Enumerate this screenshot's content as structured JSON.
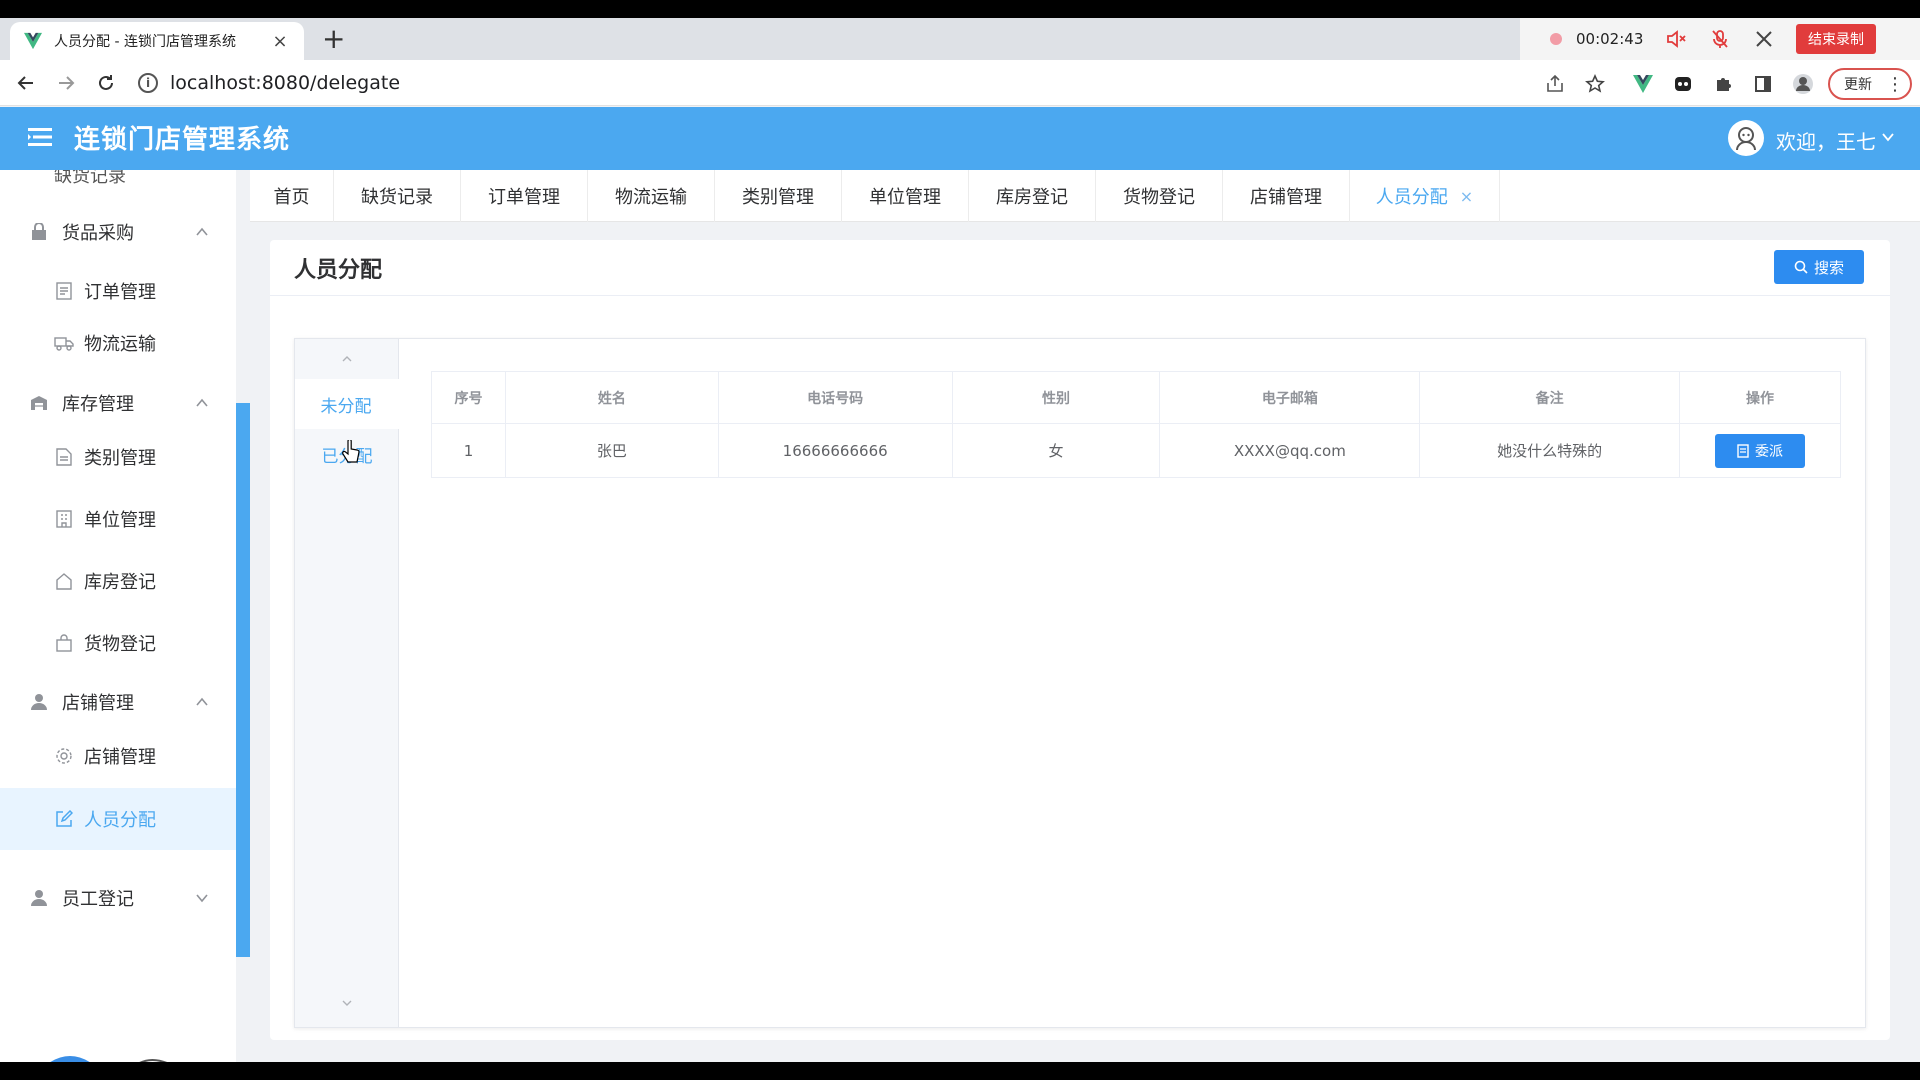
{
  "browser": {
    "tab_title": "人员分配 - 连锁门店管理系统",
    "new_tab_symbol": "+",
    "url": "localhost:8080/delegate",
    "update_label": "更新",
    "recorder": {
      "time": "00:02:43",
      "end_label": "结束录制"
    }
  },
  "header": {
    "title": "连锁门店管理系统",
    "welcome": "欢迎，王七"
  },
  "sidebar": {
    "partial_item": "缺货记录",
    "groups": [
      {
        "label": "货品采购",
        "icon": "bag-icon",
        "expanded": true,
        "items": [
          "订单管理",
          "物流运输"
        ]
      },
      {
        "label": "库存管理",
        "icon": "warehouse-icon",
        "expanded": true,
        "items": [
          "类别管理",
          "单位管理",
          "库房登记",
          "货物登记"
        ]
      },
      {
        "label": "店铺管理",
        "icon": "user-icon",
        "expanded": true,
        "items": [
          "店铺管理",
          "人员分配"
        ]
      },
      {
        "label": "员工登记",
        "icon": "user-icon",
        "expanded": false,
        "items": []
      }
    ],
    "active_item": "人员分配"
  },
  "tabs": [
    "首页",
    "缺货记录",
    "订单管理",
    "物流运输",
    "类别管理",
    "单位管理",
    "库房登记",
    "货物登记",
    "店铺管理",
    "人员分配"
  ],
  "active_tab": "人员分配",
  "page": {
    "title": "人员分配",
    "search_label": "搜索",
    "vtabs": [
      "未分配",
      "已分配"
    ],
    "active_vtab": "未分配",
    "table": {
      "columns": [
        "序号",
        "姓名",
        "电话号码",
        "性别",
        "电子邮箱",
        "备注",
        "操作"
      ],
      "rows": [
        {
          "index": "1",
          "name": "张巴",
          "phone": "16666666666",
          "gender": "女",
          "email": "XXXX@qq.com",
          "note": "她没什么特殊的",
          "action": "委派"
        }
      ]
    }
  },
  "colors": {
    "primary": "#4ba8f0",
    "button": "#2d8cf0",
    "record": "#e13c3c"
  }
}
